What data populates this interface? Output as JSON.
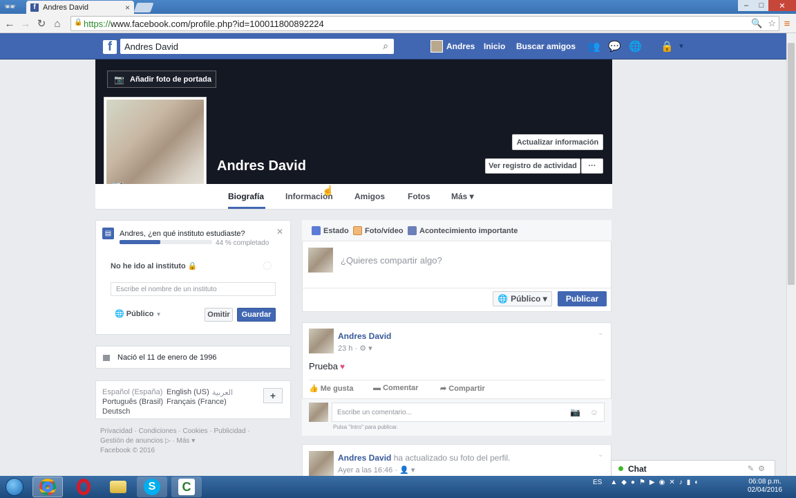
{
  "browser": {
    "tab_title": "Andres David",
    "tab_close": "×",
    "url_scheme": "https://",
    "url_rest": "www.facebook.com/profile.php?id=100011800892224",
    "window_min": "–",
    "window_max": "□",
    "window_close": "✕"
  },
  "fb_header": {
    "logo": "f",
    "search_value": "Andres David",
    "user_name": "Andres",
    "home": "Inicio",
    "find_friends": "Buscar amigos"
  },
  "profile": {
    "add_cover": "Añadir foto de portada",
    "name": "Andres David",
    "update_info": "Actualizar información",
    "activity_log": "Ver registro de actividad",
    "more_dots": "···",
    "tabs": [
      "Biografía",
      "Información",
      "Amigos",
      "Fotos",
      "Más ▾"
    ]
  },
  "school_card": {
    "question": "Andres, ¿en qué instituto estudiaste?",
    "progress_pct": 44,
    "progress_text": "44 % completado",
    "no_school": "No he ido al instituto",
    "input_placeholder": "Escribe el nombre de un instituto",
    "privacy": "Público",
    "skip": "Omitir",
    "save": "Guardar"
  },
  "born": "Nació el 11 de enero de 1996",
  "languages": {
    "line1a": "Español (España)",
    "line1b": "English (US)",
    "line1c": "العربية",
    "line2a": "Português (Brasil)",
    "line2b": "Français (France)",
    "line3": "Deutsch",
    "plus": "+"
  },
  "footer": {
    "line1": "Privacidad · Condiciones · Cookies · Publicidad ·",
    "line2": "Gestión de anuncios ▷ · Más ▾",
    "line3": "Facebook © 2016"
  },
  "composer": {
    "tab_status": "Estado",
    "tab_photo": "Foto/vídeo",
    "tab_event": "Acontecimiento importante",
    "placeholder": "¿Quieres compartir algo?",
    "privacy": "Público ▾",
    "publish": "Publicar"
  },
  "post1": {
    "author": "Andres David",
    "time": "23 h",
    "text": "Prueba",
    "like": "Me gusta",
    "comment": "Comentar",
    "share": "Compartir",
    "comment_placeholder": "Escribe un comentario...",
    "hint": "Pulsa \"Intro\" para publicar."
  },
  "post2": {
    "author": "Andres David",
    "action": "ha actualizado su foto del perfil.",
    "time": "Ayer a las 16:46"
  },
  "chat": {
    "label": "Chat"
  },
  "taskbar": {
    "lang": "ES",
    "time": "06:08 p.m.",
    "date": "02/04/2016"
  }
}
